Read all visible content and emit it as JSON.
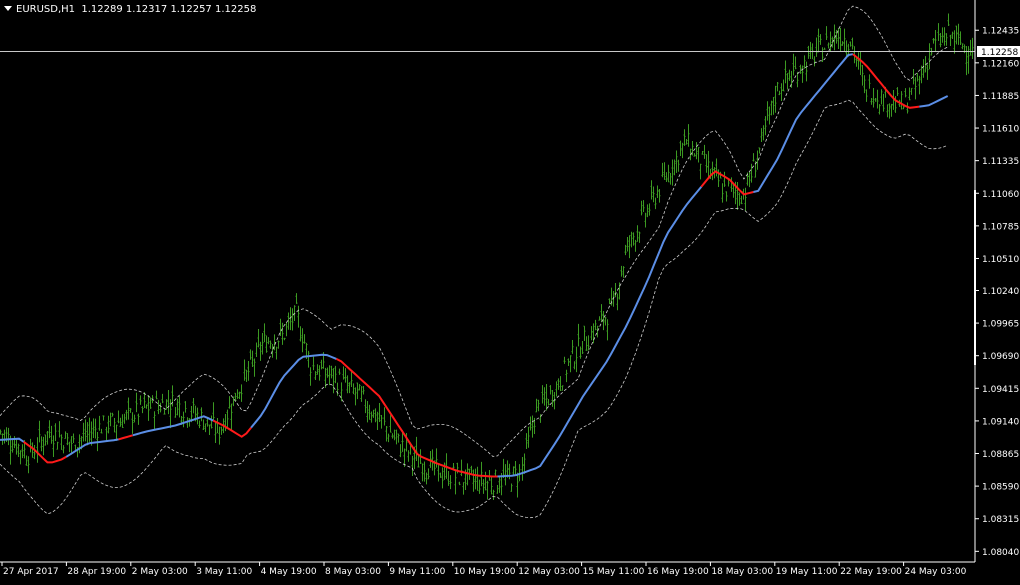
{
  "header": {
    "symbol": "EURUSD,H1",
    "ohlc": "1.12289 1.12317 1.12257 1.12258"
  },
  "current_price_label": "1.12258",
  "colors": {
    "background": "#000000",
    "bars": "#3c9a22",
    "ma_up": "#5b8ee6",
    "ma_down": "#ff1a1a",
    "envelope": "#cfcfcf",
    "axis": "#ffffff"
  },
  "chart_data": {
    "type": "line",
    "title": "EURUSD,H1",
    "ylim": [
      1.0795,
      1.1269
    ],
    "y_ticks": [
      "1.12435",
      "1.12160",
      "1.11885",
      "1.11610",
      "1.11335",
      "1.11060",
      "1.10785",
      "1.10510",
      "1.10240",
      "1.09965",
      "1.09690",
      "1.09415",
      "1.09140",
      "1.08865",
      "1.08590",
      "1.08315",
      "1.08040"
    ],
    "x_ticks": [
      "27 Apr 2017",
      "28 Apr 19:00",
      "2 May 03:00",
      "3 May 11:00",
      "4 May 19:00",
      "8 May 03:00",
      "9 May 11:00",
      "10 May 19:00",
      "12 May 03:00",
      "15 May 11:00",
      "16 May 19:00",
      "18 May 03:00",
      "19 May 11:00",
      "22 May 19:00",
      "24 May 03:00"
    ],
    "current_price": 1.12258,
    "close_path": [
      [
        0,
        1.0905
      ],
      [
        0.03,
        1.0885
      ],
      [
        0.05,
        1.0905
      ],
      [
        0.075,
        1.0895
      ],
      [
        0.1,
        1.0908
      ],
      [
        0.125,
        1.0915
      ],
      [
        0.15,
        1.0925
      ],
      [
        0.175,
        1.093
      ],
      [
        0.2,
        1.092
      ],
      [
        0.225,
        1.0905
      ],
      [
        0.245,
        1.094
      ],
      [
        0.27,
        1.098
      ],
      [
        0.29,
        1.0985
      ],
      [
        0.305,
        1.1005
      ],
      [
        0.32,
        1.096
      ],
      [
        0.345,
        1.095
      ],
      [
        0.37,
        1.0935
      ],
      [
        0.39,
        1.0915
      ],
      [
        0.41,
        1.0895
      ],
      [
        0.43,
        1.088
      ],
      [
        0.455,
        1.087
      ],
      [
        0.48,
        1.0865
      ],
      [
        0.5,
        1.0862
      ],
      [
        0.52,
        1.0865
      ],
      [
        0.535,
        1.087
      ],
      [
        0.55,
        1.092
      ],
      [
        0.57,
        1.094
      ],
      [
        0.59,
        1.097
      ],
      [
        0.61,
        1.099
      ],
      [
        0.63,
        1.101
      ],
      [
        0.645,
        1.106
      ],
      [
        0.665,
        1.109
      ],
      [
        0.685,
        1.112
      ],
      [
        0.705,
        1.115
      ],
      [
        0.725,
        1.113
      ],
      [
        0.745,
        1.111
      ],
      [
        0.765,
        1.1105
      ],
      [
        0.78,
        1.114
      ],
      [
        0.8,
        1.1195
      ],
      [
        0.82,
        1.121
      ],
      [
        0.84,
        1.1225
      ],
      [
        0.86,
        1.124
      ],
      [
        0.875,
        1.1235
      ],
      [
        0.89,
        1.1195
      ],
      [
        0.91,
        1.1185
      ],
      [
        0.93,
        1.118
      ],
      [
        0.945,
        1.12
      ],
      [
        0.96,
        1.123
      ],
      [
        0.975,
        1.124
      ],
      [
        1.0,
        1.12258
      ]
    ],
    "ma_path": [
      [
        0,
        1.0898
      ],
      [
        0.02,
        1.0899
      ],
      [
        0.035,
        1.089
      ],
      [
        0.05,
        1.0878
      ],
      [
        0.065,
        1.0882
      ],
      [
        0.09,
        1.0895
      ],
      [
        0.12,
        1.0898
      ],
      [
        0.15,
        1.0905
      ],
      [
        0.18,
        1.091
      ],
      [
        0.21,
        1.0918
      ],
      [
        0.23,
        1.091
      ],
      [
        0.25,
        1.09
      ],
      [
        0.27,
        1.092
      ],
      [
        0.29,
        1.095
      ],
      [
        0.31,
        1.0968
      ],
      [
        0.335,
        1.097
      ],
      [
        0.35,
        1.0965
      ],
      [
        0.37,
        1.095
      ],
      [
        0.39,
        1.0935
      ],
      [
        0.41,
        1.091
      ],
      [
        0.43,
        1.0885
      ],
      [
        0.45,
        1.0878
      ],
      [
        0.47,
        1.0872
      ],
      [
        0.49,
        1.0868
      ],
      [
        0.51,
        1.0867
      ],
      [
        0.53,
        1.0868
      ],
      [
        0.555,
        1.0875
      ],
      [
        0.575,
        1.09
      ],
      [
        0.6,
        1.0935
      ],
      [
        0.625,
        1.0965
      ],
      [
        0.645,
        1.0995
      ],
      [
        0.665,
        1.103
      ],
      [
        0.685,
        1.107
      ],
      [
        0.705,
        1.1095
      ],
      [
        0.72,
        1.111
      ],
      [
        0.735,
        1.1125
      ],
      [
        0.75,
        1.1118
      ],
      [
        0.765,
        1.1105
      ],
      [
        0.78,
        1.1108
      ],
      [
        0.8,
        1.1135
      ],
      [
        0.82,
        1.117
      ],
      [
        0.84,
        1.119
      ],
      [
        0.86,
        1.121
      ],
      [
        0.875,
        1.1225
      ],
      [
        0.89,
        1.1215
      ],
      [
        0.905,
        1.12
      ],
      [
        0.92,
        1.1185
      ],
      [
        0.935,
        1.1178
      ],
      [
        0.955,
        1.118
      ],
      [
        0.975,
        1.1188
      ]
    ],
    "ma_down_segments": [
      [
        0.02,
        0.065
      ],
      [
        0.12,
        0.135
      ],
      [
        0.215,
        0.255
      ],
      [
        0.345,
        0.51
      ],
      [
        0.72,
        0.775
      ],
      [
        0.875,
        0.945
      ]
    ]
  }
}
